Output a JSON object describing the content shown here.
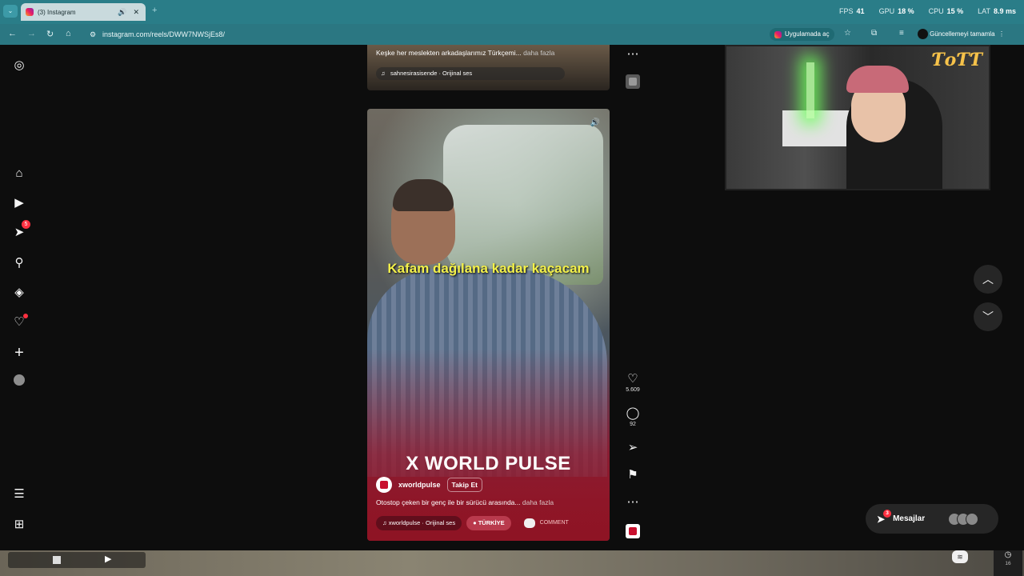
{
  "browser": {
    "tab_title": "(3) Instagram",
    "url": "instagram.com/reels/DWW7NWSjEs8/",
    "open_in_app": "Uygulamada aç",
    "update_label": "Güncellemeyi tamamla",
    "stats": {
      "fps_label": "FPS",
      "fps": "41",
      "gpu_label": "GPU",
      "gpu": "18 %",
      "cpu_label": "CPU",
      "cpu": "15 %",
      "lat_label": "LAT",
      "lat": "8.9 ms"
    }
  },
  "sidebar": {
    "notifications_badge": "5"
  },
  "previous_reel": {
    "caption": "Keşke her meslekten arkadaşlarımız Türkçemi...",
    "more": "daha fazla",
    "audio": "sahnesirasisende · Orijinal ses"
  },
  "reel": {
    "subtitle": "Kafam dağılana kadar kaçacam",
    "watermark": "X WORLD PULSE",
    "author": "xworldpulse",
    "follow": "Takip Et",
    "caption": "Otostop çeken bir genç ile bir sürücü arasında...",
    "more": "daha fazla",
    "audio": "xworldpulse · Orijinal ses",
    "location": "TÜRKİYE",
    "comment_chip": "COMMENT",
    "likes": "5.609",
    "comments": "92"
  },
  "messages": {
    "label": "Mesajlar",
    "badge": "3"
  },
  "taskbar": {
    "clock_number": "16"
  },
  "colors": {
    "tab_bar": "#2a7d88",
    "address_bar": "#2b7782",
    "badge_red": "#ff3040",
    "subtitle_yellow": "#f4f14a",
    "reel_bottom": "#8e1424"
  }
}
